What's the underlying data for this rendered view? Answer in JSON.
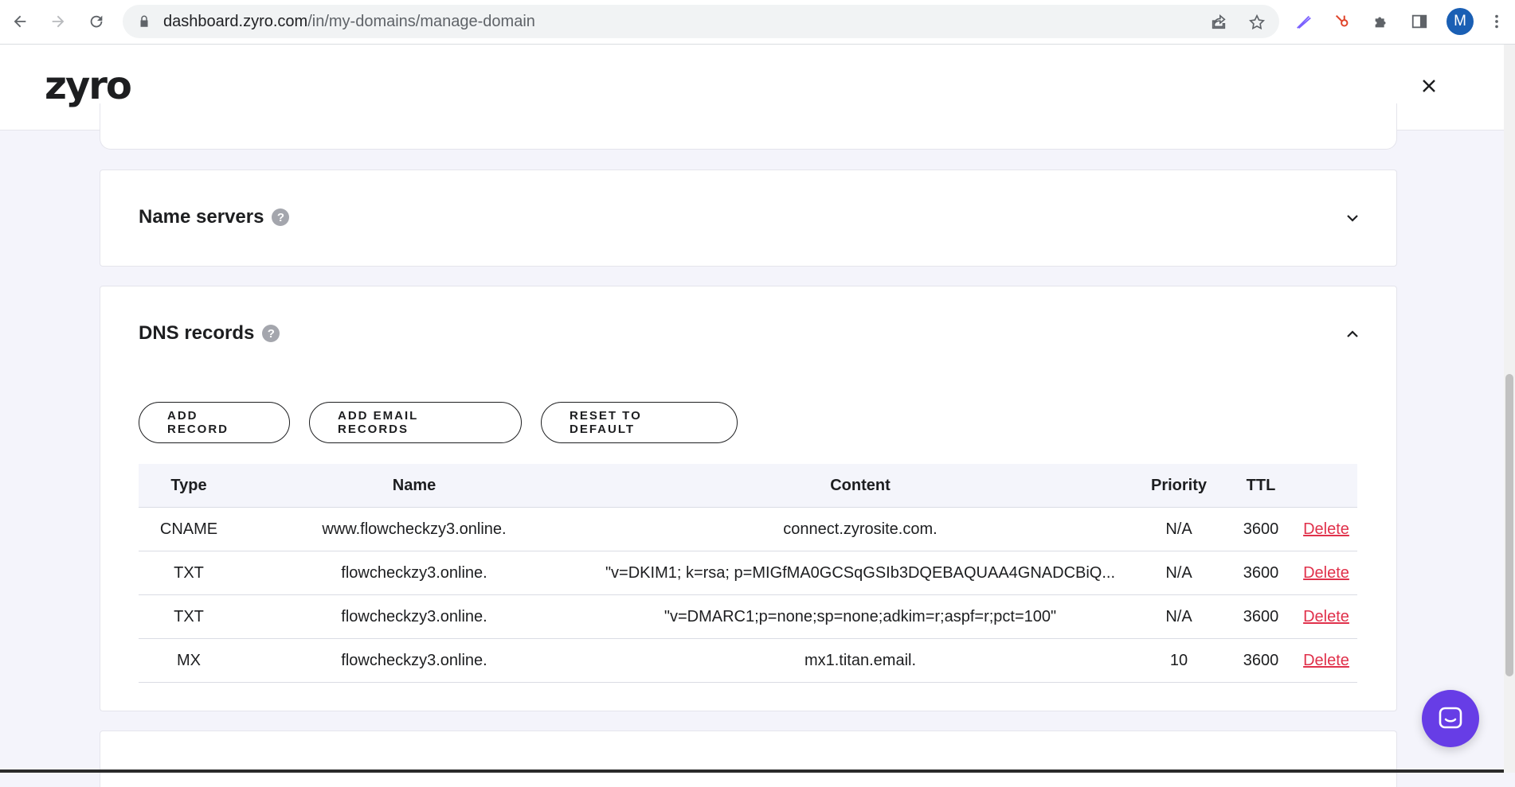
{
  "browser": {
    "url_domain": "dashboard.zyro.com",
    "url_path": "/in/my-domains/manage-domain",
    "profile_initial": "M",
    "icons": [
      "back-arrow-icon",
      "forward-arrow-icon",
      "reload-icon",
      "lock-icon",
      "share-icon",
      "star-icon",
      "pen-extension-icon",
      "hubspot-extension-icon",
      "puzzle-extensions-icon",
      "side-panel-icon",
      "more-vert-icon"
    ]
  },
  "header": {
    "logo_text": "zyro"
  },
  "sections": {
    "name_servers": {
      "title": "Name servers",
      "help": "?"
    },
    "dns_records": {
      "title": "DNS records",
      "help": "?"
    }
  },
  "dns": {
    "buttons": {
      "add_record": "ADD RECORD",
      "add_email_records": "ADD EMAIL RECORDS",
      "reset_to_default": "RESET TO DEFAULT"
    },
    "columns": {
      "type": "Type",
      "name": "Name",
      "content": "Content",
      "priority": "Priority",
      "ttl": "TTL"
    },
    "rows": [
      {
        "type": "CNAME",
        "name": "www.flowcheckzy3.online.",
        "content": "connect.zyrosite.com.",
        "priority": "N/A",
        "ttl": "3600",
        "action": "Delete"
      },
      {
        "type": "TXT",
        "name": "flowcheckzy3.online.",
        "content": "\"v=DKIM1; k=rsa; p=MIGfMA0GCSqGSIb3DQEBAQUAA4GNADCBiQ...",
        "priority": "N/A",
        "ttl": "3600",
        "action": "Delete"
      },
      {
        "type": "TXT",
        "name": "flowcheckzy3.online.",
        "content": "\"v=DMARC1;p=none;sp=none;adkim=r;aspf=r;pct=100\"",
        "priority": "N/A",
        "ttl": "3600",
        "action": "Delete"
      },
      {
        "type": "MX",
        "name": "flowcheckzy3.online.",
        "content": "mx1.titan.email.",
        "priority": "10",
        "ttl": "3600",
        "action": "Delete"
      }
    ]
  },
  "colors": {
    "accent": "#673de6",
    "delete": "#e0314b",
    "profile": "#1a5fb4"
  }
}
